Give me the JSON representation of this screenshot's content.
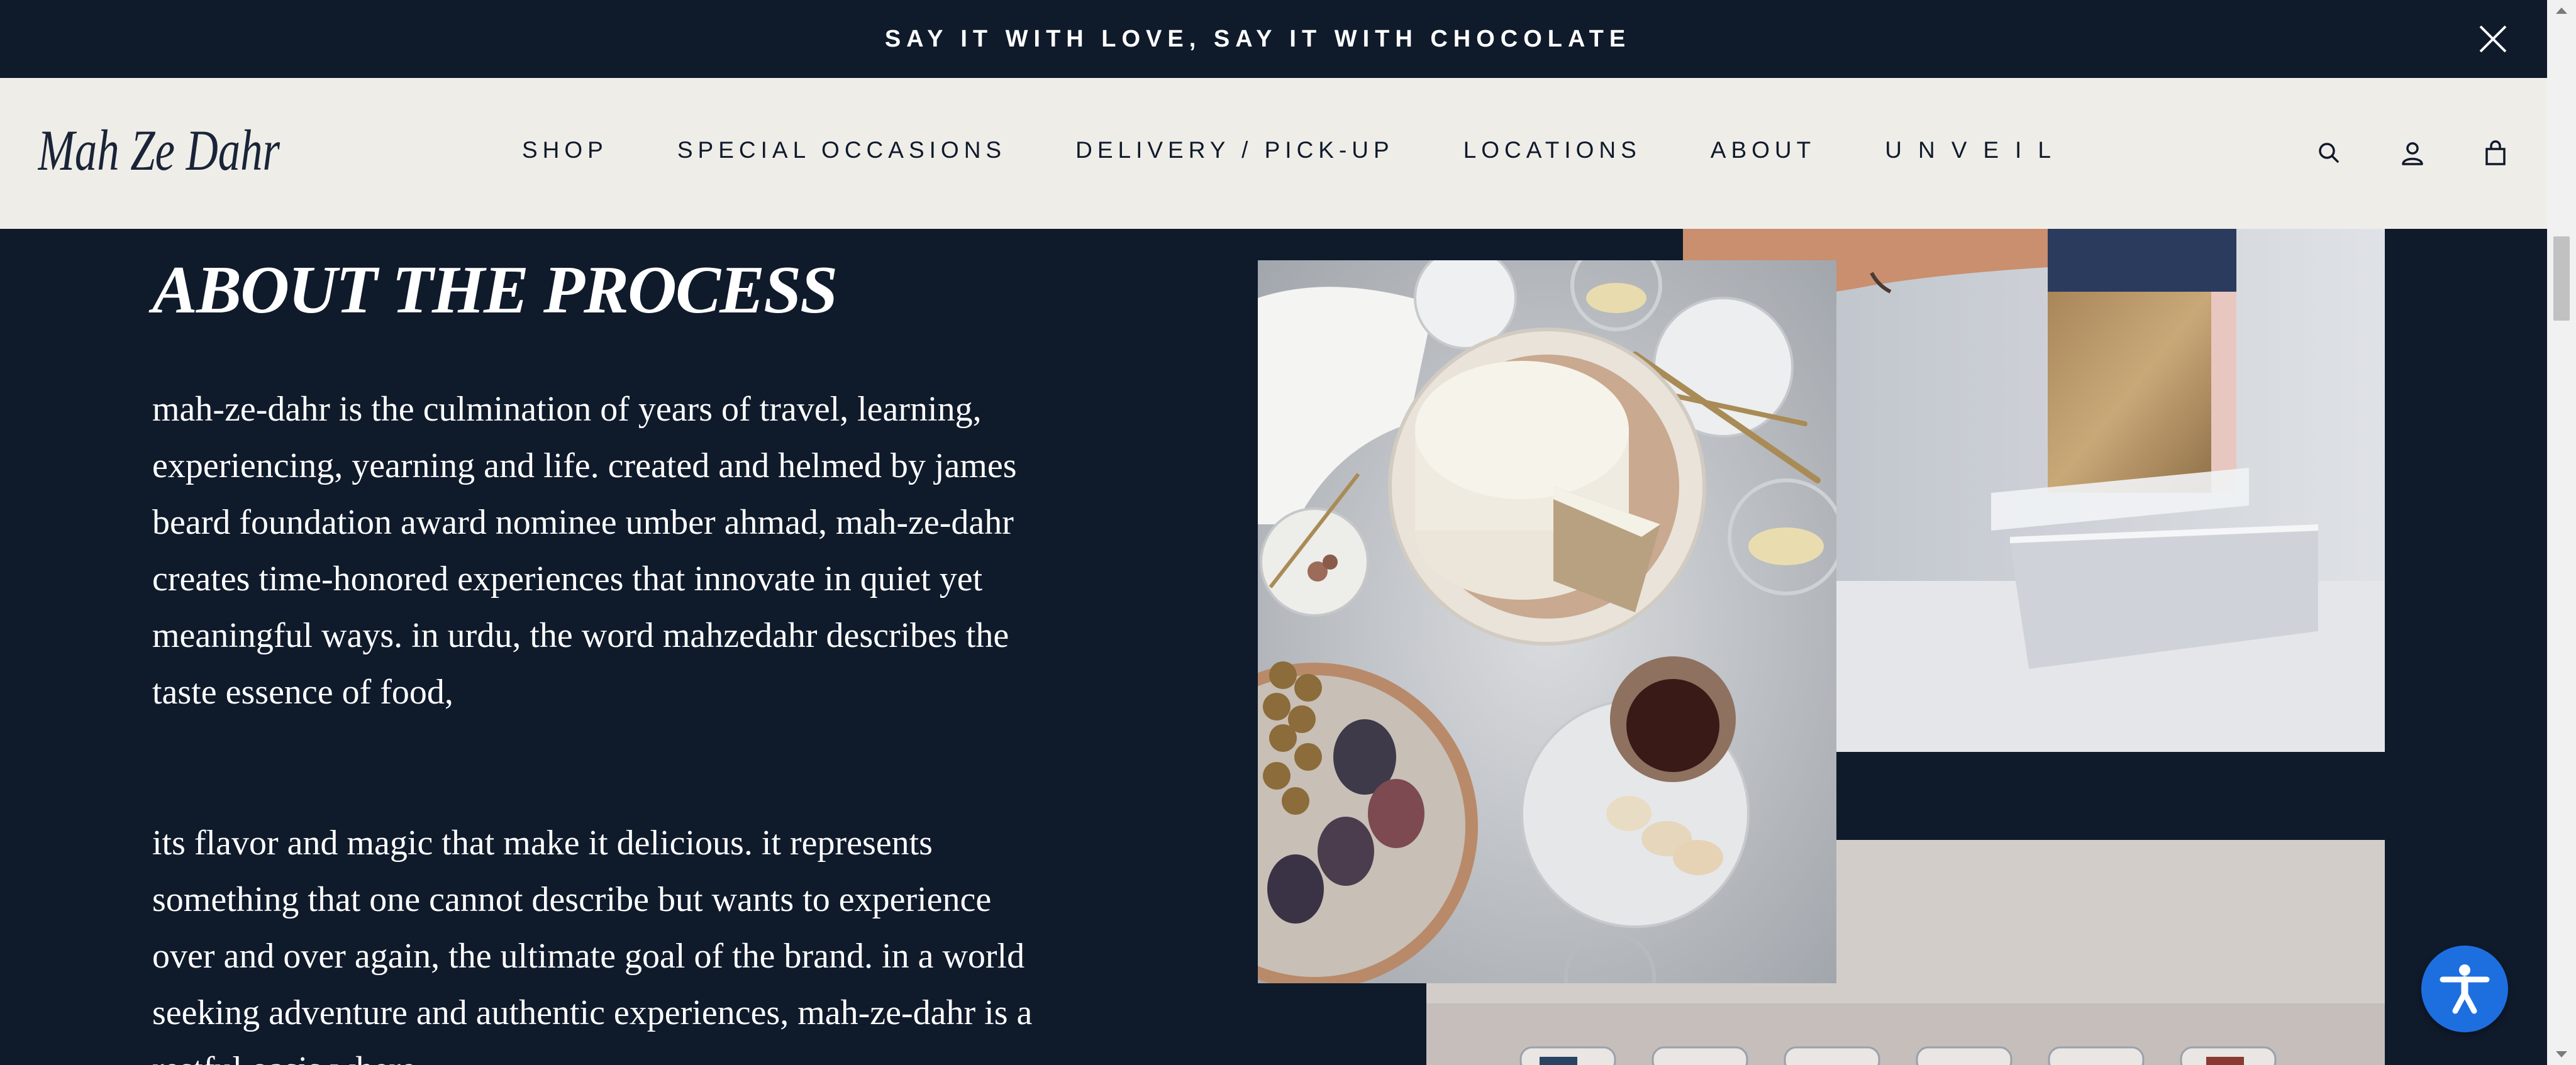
{
  "announcement": {
    "text": "SAY IT WITH LOVE, SAY IT WITH CHOCOLATE",
    "close_icon": "close-icon"
  },
  "header": {
    "logo_text": "Mah Ze Dahr",
    "nav": [
      {
        "label": "SHOP"
      },
      {
        "label": "SPECIAL OCCASIONS"
      },
      {
        "label": "DELIVERY / PICK-UP"
      },
      {
        "label": "LOCATIONS"
      },
      {
        "label": "ABOUT"
      },
      {
        "label": "UNVEIL"
      }
    ],
    "icons": [
      "search-icon",
      "account-icon",
      "bag-icon"
    ]
  },
  "main": {
    "heading": "ABOUT THE PROCESS",
    "paragraph_1": "mah-ze-dahr is the culmination of years of travel, learning, experiencing, yearning and life. created and helmed by james beard foundation award nominee umber ahmad, mah-ze-dahr creates time-honored experiences that innovate in quiet yet meaningful ways. in urdu, the word mahzedahr describes the taste essence of food,",
    "paragraph_2": "its flavor and magic that make it delicious. it represents something that one cannot describe but wants to experience over and over again, the ultimate goal of the brand. in a world seeking adventure and authentic experiences, mah-ze-dahr is a restful oasis where"
  },
  "colors": {
    "navy": "#0f1a2b",
    "cream": "#efede8",
    "accessibility_blue": "#1d6fe0"
  },
  "accessibility": {
    "icon": "accessibility-icon"
  }
}
